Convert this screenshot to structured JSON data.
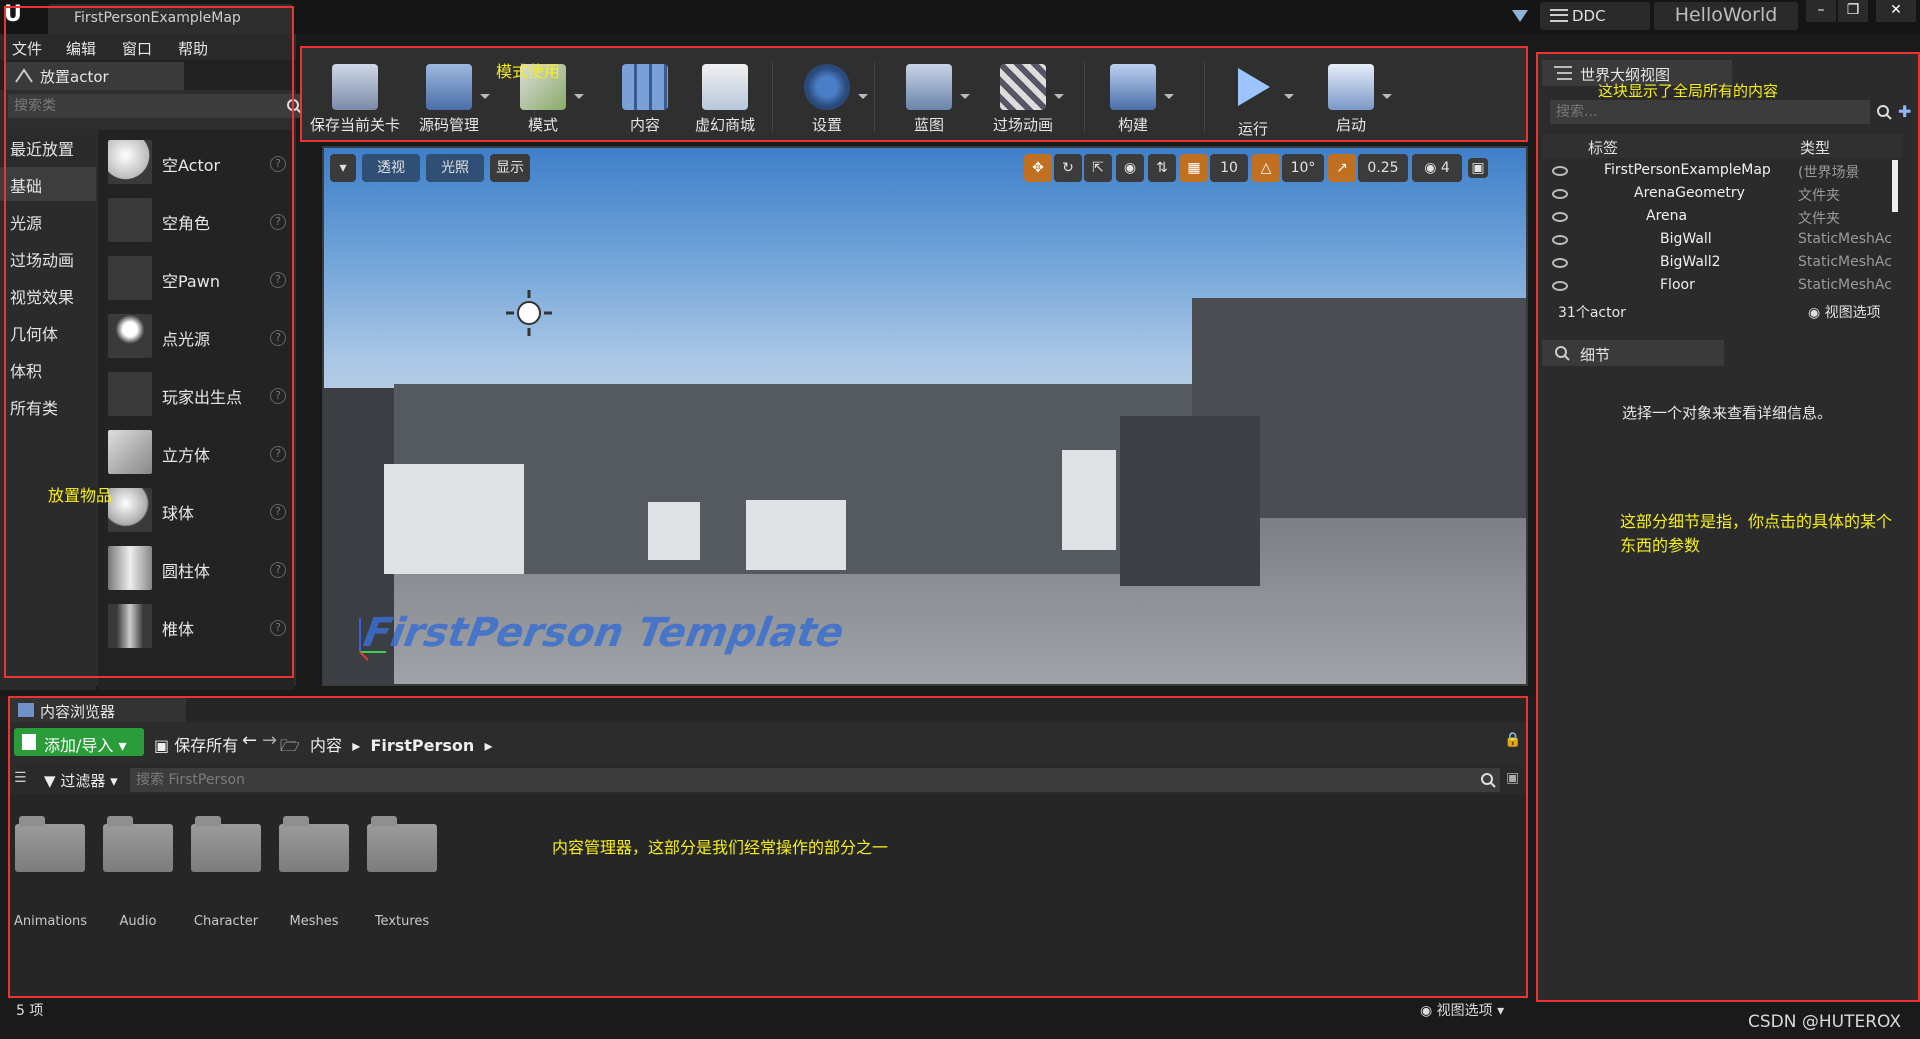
{
  "titlebar": {
    "map_tab": "FirstPersonExampleMap",
    "ddc": "DDC",
    "project": "HelloWorld"
  },
  "menu": [
    "文件",
    "编辑",
    "窗口",
    "帮助"
  ],
  "place_actor": {
    "tab": "放置actor",
    "search_placeholder": "搜索类",
    "categories": [
      "最近放置",
      "基础",
      "光源",
      "过场动画",
      "视觉效果",
      "几何体",
      "体积",
      "所有类"
    ],
    "actors": [
      "空Actor",
      "空角色",
      "空Pawn",
      "点光源",
      "玩家出生点",
      "立方体",
      "球体",
      "圆柱体",
      "椎体"
    ]
  },
  "toolbar": {
    "items": [
      "保存当前关卡",
      "源码管理",
      "模式",
      "内容",
      "虚幻商城",
      "设置",
      "蓝图",
      "过场动画",
      "构建",
      "运行",
      "启动"
    ]
  },
  "viewport": {
    "perspective": "透视",
    "lit": "光照",
    "show": "显示",
    "grid_snap": "10",
    "rot_snap": "10°",
    "scale_snap": "0.25",
    "cam_speed": "4",
    "floor_text": "FirstPerson Template"
  },
  "outliner": {
    "tab": "世界大纲视图",
    "search_placeholder": "搜索...",
    "col_label": "标签",
    "col_type": "类型",
    "rows": [
      {
        "name": "FirstPersonExampleMap",
        "type": "(世界场景"
      },
      {
        "name": "ArenaGeometry",
        "type": "文件夹"
      },
      {
        "name": "Arena",
        "type": "文件夹"
      },
      {
        "name": "BigWall",
        "type": "StaticMeshAc"
      },
      {
        "name": "BigWall2",
        "type": "StaticMeshAc"
      },
      {
        "name": "Floor",
        "type": "StaticMeshAc"
      }
    ],
    "actor_count": "31个actor",
    "view_options": "视图选项"
  },
  "details": {
    "tab": "细节",
    "message": "选择一个对象来查看详细信息。"
  },
  "content_browser": {
    "tab": "内容浏览器",
    "add_import": "添加/导入",
    "save_all": "保存所有",
    "crumb_root": "内容",
    "crumb_current": "FirstPerson",
    "filter": "过滤器",
    "search_placeholder": "搜索 FirstPerson",
    "folders": [
      "Animations",
      "Audio",
      "Character",
      "Meshes",
      "Textures"
    ],
    "item_count": "5 项",
    "view_options": "视图选项"
  },
  "annotations": {
    "modes": "模式使用",
    "place": "放置物品",
    "outliner": "这块显示了全局所有的内容",
    "details_1": "这部分细节是指，你点击的具体的某个",
    "details_2": "东西的参数",
    "content": "内容管理器，这部分是我们经常操作的部分之一"
  },
  "watermark": "CSDN @HUTEROX",
  "colors": {
    "annotation": "#f6f01a",
    "highlight_box": "#ee3333",
    "add_button": "#2a9d3a"
  }
}
